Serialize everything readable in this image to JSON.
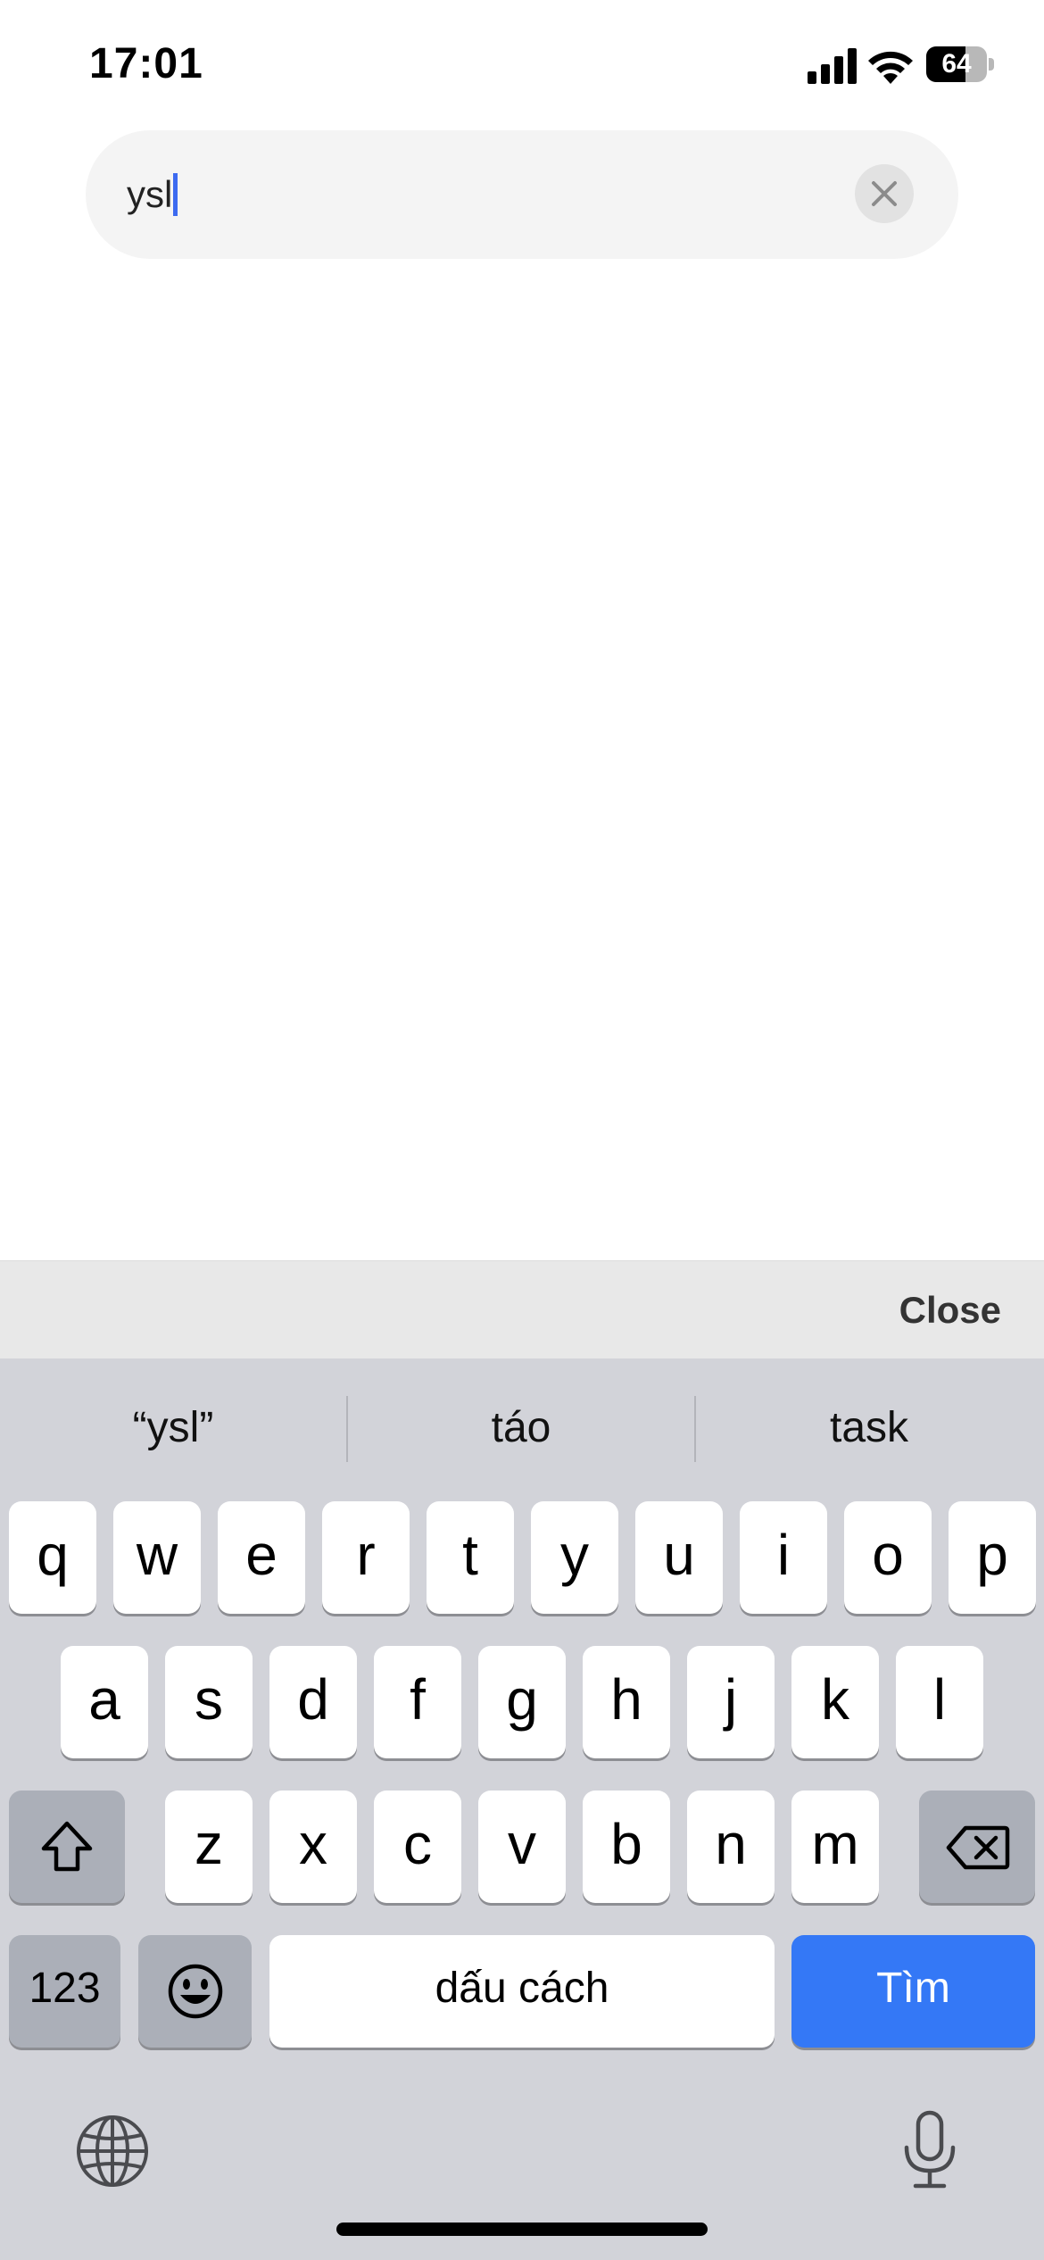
{
  "status_bar": {
    "time": "17:01",
    "battery_percent": "64",
    "battery_level": 0.64
  },
  "search": {
    "value": "ysl",
    "clear_icon": "x-mark-icon"
  },
  "accessory": {
    "close_label": "Close"
  },
  "keyboard": {
    "suggestions": [
      "“ysl”",
      "táo",
      "task"
    ],
    "row1": [
      "q",
      "w",
      "e",
      "r",
      "t",
      "y",
      "u",
      "i",
      "o",
      "p"
    ],
    "row2": [
      "a",
      "s",
      "d",
      "f",
      "g",
      "h",
      "j",
      "k",
      "l"
    ],
    "row3": [
      "z",
      "x",
      "c",
      "v",
      "b",
      "n",
      "m"
    ],
    "numbers_label": "123",
    "space_label": "dấu cách",
    "search_key_label": "Tìm",
    "icons": {
      "shift": "shift-icon",
      "backspace": "backspace-icon",
      "emoji": "emoji-icon",
      "globe": "globe-icon",
      "microphone": "microphone-icon"
    }
  },
  "colors": {
    "caret": "#3d6af0",
    "search_key": "#3478f6",
    "keyboard_bg": "#d2d3d9"
  }
}
